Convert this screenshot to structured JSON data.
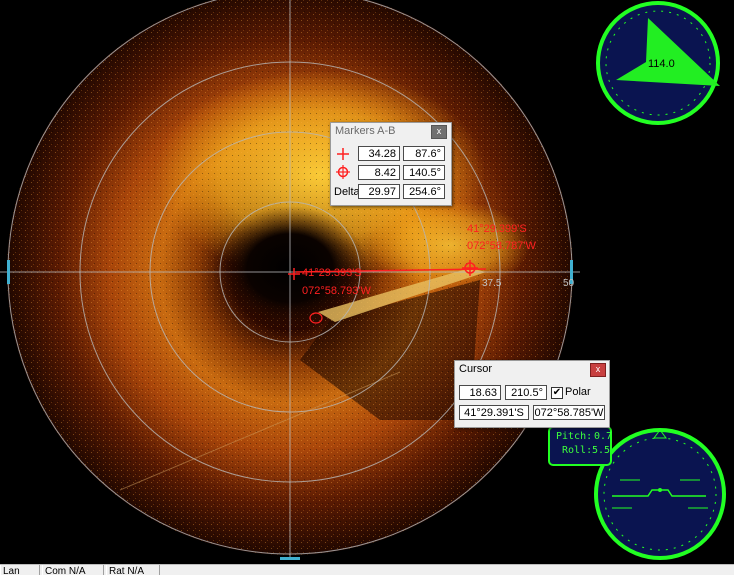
{
  "colors": {
    "sonar_dark": "#2a0a00",
    "sonar_bright": "#ffc21a",
    "overlay_red": "#ff2020",
    "grid": "#c0c0c0",
    "gauge_green": "#22ff22",
    "gauge_navy": "#0a1450"
  },
  "sonar": {
    "range_label_inner": "37.5",
    "range_label_outer": "50",
    "marker_a_coord": {
      "lat": "41°29.393'S",
      "lon": "072°58.793'W"
    },
    "marker_b_coord": {
      "lat": "41°29.399'S",
      "lon": "072°58.787'W"
    }
  },
  "heading_gauge": {
    "value": "114.0",
    "icon": "heading-arrow-icon"
  },
  "attitude_gauge": {
    "pitch_label": "Pitch:",
    "pitch": "0.7",
    "roll_label": "Roll:",
    "roll": "5.5"
  },
  "markers_window": {
    "title": "Markers A-B",
    "close": "x",
    "rows": [
      {
        "icon": "crosshair-icon",
        "distance": "34.28",
        "bearing": "87.6°"
      },
      {
        "icon": "target-circle-icon",
        "distance": "8.42",
        "bearing": "140.5°"
      },
      {
        "label": "Delta",
        "distance": "29.97",
        "bearing": "254.6°"
      }
    ]
  },
  "cursor_window": {
    "title": "Cursor",
    "close": "x",
    "range": "18.63",
    "bearing": "210.5°",
    "polar_label": "Polar",
    "polar_checked": true,
    "lat": "41°29.391'S",
    "lon": "072°58.785'W"
  },
  "status_bar": [
    "Lan",
    "Com N/A",
    "Rat N/A"
  ]
}
